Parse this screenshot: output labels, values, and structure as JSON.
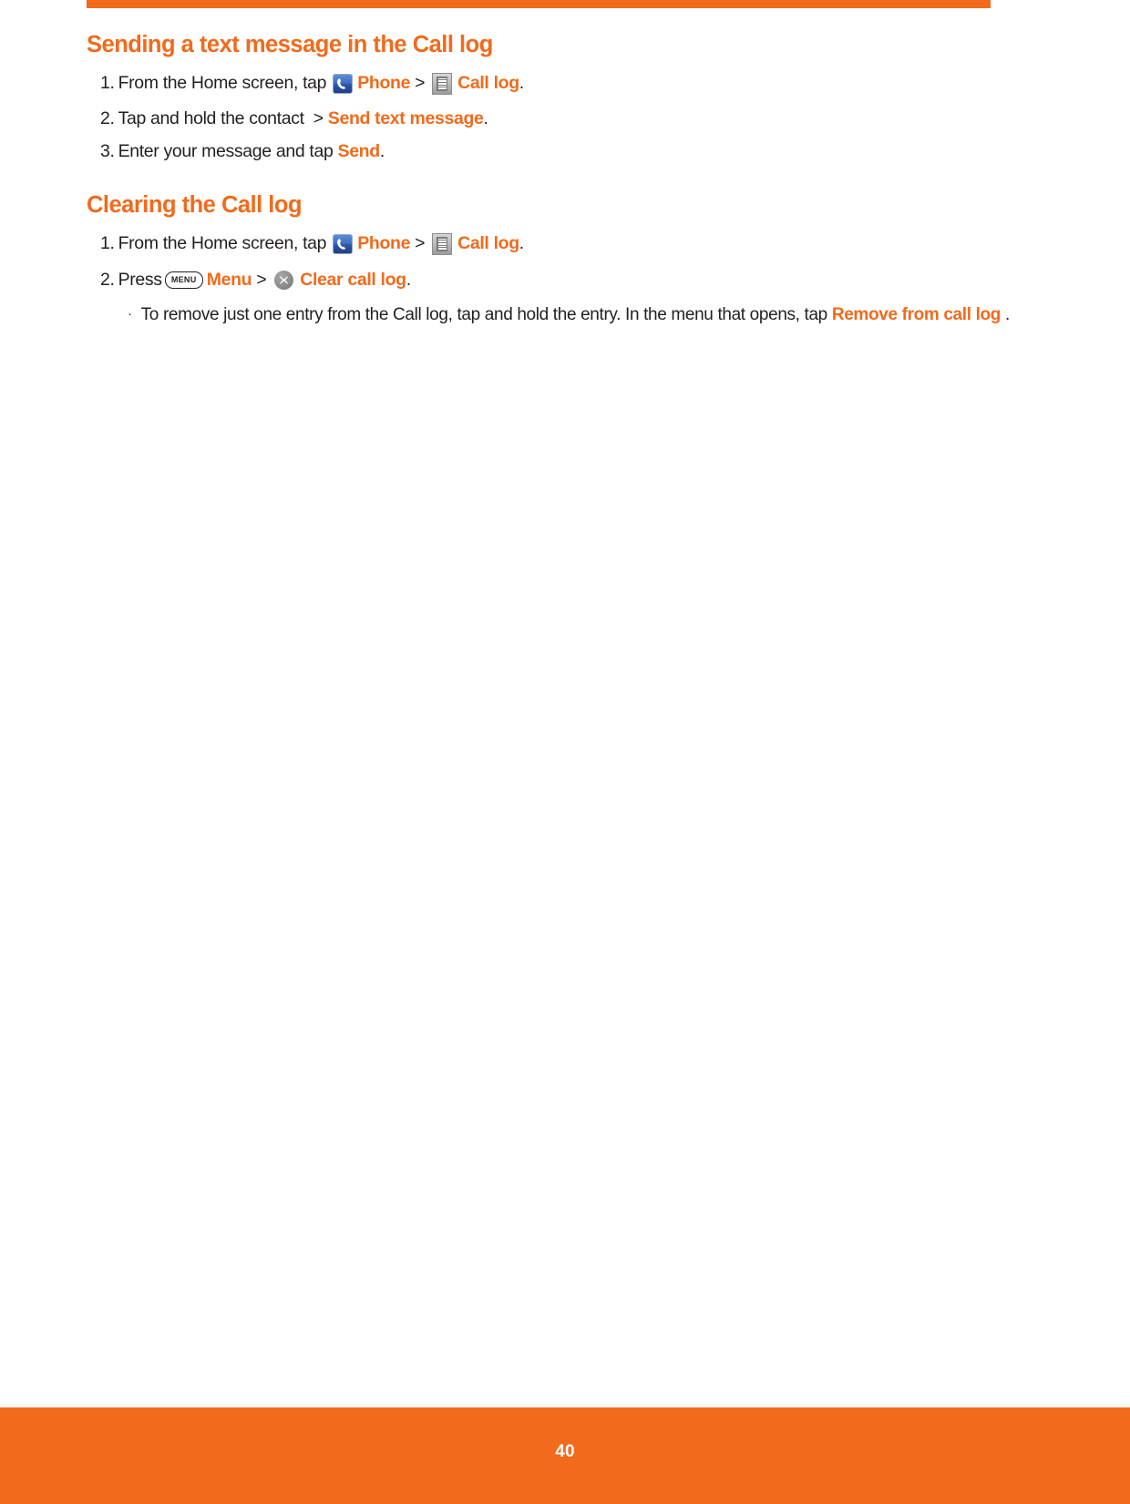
{
  "page": {
    "number": "40",
    "accent_color": "#F26A1B",
    "text_color": "#231f20"
  },
  "sections": [
    {
      "heading": "Sending a text message in the Call log",
      "steps": [
        {
          "number": "1.",
          "parts": [
            {
              "type": "text",
              "text": "From the Home screen, tap "
            },
            {
              "type": "icon",
              "icon": "phone-icon"
            },
            {
              "type": "orange",
              "text": "Phone"
            },
            {
              "type": "gt",
              "text": ">"
            },
            {
              "type": "icon",
              "icon": "call-log-icon"
            },
            {
              "type": "orange",
              "text": "Call log"
            },
            {
              "type": "text",
              "text": "."
            }
          ]
        },
        {
          "number": "2.",
          "parts": [
            {
              "type": "text",
              "text": "Tap and hold the contact "
            },
            {
              "type": "gt",
              "text": ">"
            },
            {
              "type": "orange",
              "text": "Send text message"
            },
            {
              "type": "text",
              "text": "."
            }
          ]
        },
        {
          "number": "3.",
          "parts": [
            {
              "type": "text",
              "text": "Enter your message and tap "
            },
            {
              "type": "orange",
              "text": "Send"
            },
            {
              "type": "text",
              "text": "."
            }
          ]
        }
      ]
    },
    {
      "heading": "Clearing the Call log",
      "steps": [
        {
          "number": "1.",
          "parts": [
            {
              "type": "text",
              "text": "From the Home screen, tap "
            },
            {
              "type": "icon",
              "icon": "phone-icon"
            },
            {
              "type": "orange",
              "text": "Phone"
            },
            {
              "type": "gt",
              "text": ">"
            },
            {
              "type": "icon",
              "icon": "call-log-icon"
            },
            {
              "type": "orange",
              "text": "Call log"
            },
            {
              "type": "text",
              "text": "."
            }
          ]
        },
        {
          "number": "2.",
          "parts": [
            {
              "type": "text",
              "text": "Press"
            },
            {
              "type": "icon",
              "icon": "menu-key-icon",
              "label": "MENU"
            },
            {
              "type": "orange",
              "text": "Menu"
            },
            {
              "type": "gt",
              "text": ">"
            },
            {
              "type": "icon",
              "icon": "clear-call-log-icon"
            },
            {
              "type": "orange",
              "text": "Clear call log"
            },
            {
              "type": "text",
              "text": "."
            }
          ]
        }
      ],
      "bullets": [
        {
          "marker": "·",
          "parts": [
            {
              "type": "text",
              "text": "To remove just one entry from the Call log, tap and hold the entry. In the menu that opens, tap "
            },
            {
              "type": "orange",
              "text": "Remove from call log"
            },
            {
              "type": "text",
              "text": " ."
            }
          ]
        }
      ]
    }
  ]
}
